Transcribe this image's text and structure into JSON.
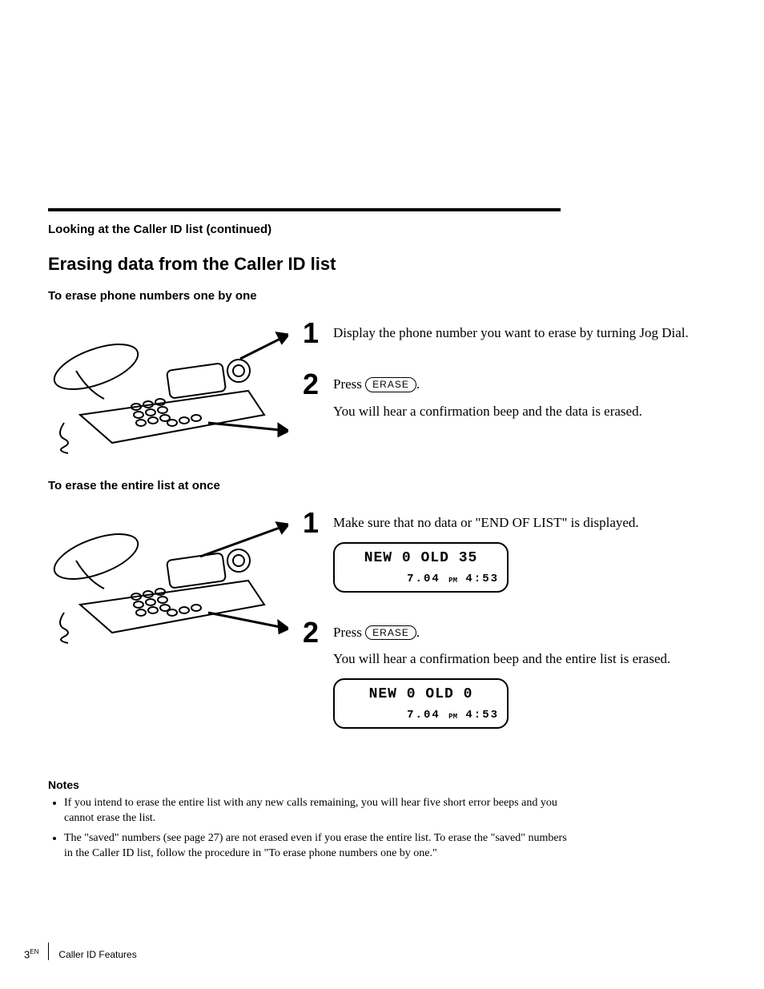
{
  "breadcrumb": "Looking at the Caller ID list (continued)",
  "section_title": "Erasing data from the Caller ID list",
  "sub1_title": "To erase phone numbers one by one",
  "sub2_title": "To erase the entire list at once",
  "erase_button": "ERASE",
  "press_word": "Press",
  "period": ".",
  "sec1": {
    "step1": "Display the phone number you want to erase by turning Jog Dial.",
    "step2_after": "You will hear a confirmation beep and the data is erased."
  },
  "sec2": {
    "step1": "Make sure that no data or \"END OF LIST\" is displayed.",
    "step2_after": "You will hear a confirmation beep and the entire list is erased."
  },
  "lcd1": {
    "line1": "NEW 0  OLD 35",
    "time_a": "7.04",
    "pm": "PM",
    "time_b": "4:53"
  },
  "lcd2": {
    "line1": "NEW 0  OLD 0",
    "time_a": "7.04",
    "pm": "PM",
    "time_b": "4:53"
  },
  "notes_heading": "Notes",
  "notes": [
    "If you intend to erase the entire list with any new calls remaining, you will hear five short error beeps and you cannot erase the list.",
    "The \"saved\" numbers (see page 27) are not erased even if you erase the entire list. To erase the \"saved\" numbers in the Caller ID list, follow the procedure in \"To erase phone numbers one by one.\""
  ],
  "footer": {
    "page_prefix": "3",
    "page_sup": "EN",
    "section": "Caller ID Features"
  }
}
